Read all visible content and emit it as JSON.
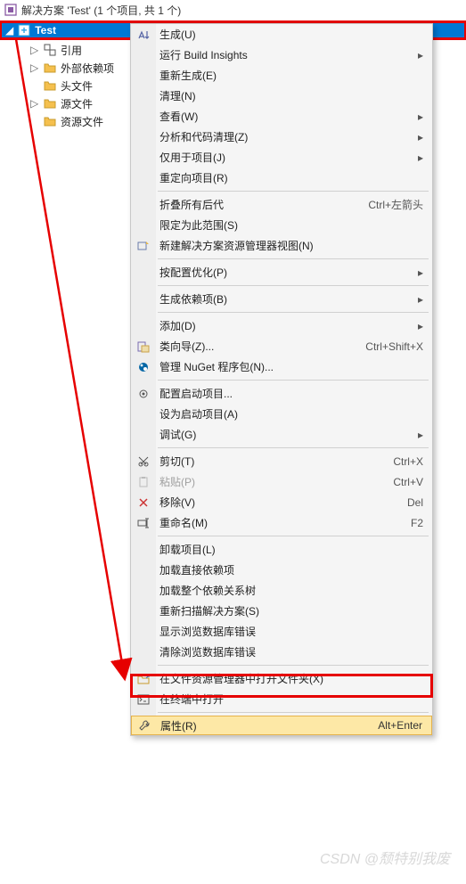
{
  "solution_title": "解决方案 'Test' (1 个项目, 共 1 个)",
  "project_name": "Test",
  "tree": {
    "references": "引用",
    "external_deps": "外部依赖项",
    "headers": "头文件",
    "sources": "源文件",
    "resources": "资源文件"
  },
  "menu": {
    "build": "生成(U)",
    "build_insights": "运行 Build Insights",
    "rebuild": "重新生成(E)",
    "clean": "清理(N)",
    "view": "查看(W)",
    "analyze": "分析和代码清理(Z)",
    "project_only": "仅用于项目(J)",
    "retarget": "重定向项目(R)",
    "collapse_all": "折叠所有后代",
    "collapse_shortcut": "Ctrl+左箭头",
    "scope_to_this": "限定为此范围(S)",
    "new_solution_explorer": "新建解决方案资源管理器视图(N)",
    "optimize_config": "按配置优化(P)",
    "build_deps": "生成依赖项(B)",
    "add": "添加(D)",
    "class_wizard": "类向导(Z)...",
    "class_wizard_shortcut": "Ctrl+Shift+X",
    "manage_nuget": "管理 NuGet 程序包(N)...",
    "configure_startup": "配置启动项目...",
    "set_as_startup": "设为启动项目(A)",
    "debug": "调试(G)",
    "cut": "剪切(T)",
    "cut_shortcut": "Ctrl+X",
    "paste": "粘贴(P)",
    "paste_shortcut": "Ctrl+V",
    "remove": "移除(V)",
    "remove_shortcut": "Del",
    "rename": "重命名(M)",
    "rename_shortcut": "F2",
    "unload": "卸载项目(L)",
    "load_direct_deps": "加载直接依赖项",
    "load_all_deps": "加载整个依赖关系树",
    "rescan": "重新扫描解决方案(S)",
    "show_browse_db_errors": "显示浏览数据库错误",
    "clear_browse_db_errors": "清除浏览数据库错误",
    "open_in_explorer": "在文件资源管理器中打开文件夹(X)",
    "open_in_terminal": "在终端中打开",
    "properties": "属性(R)",
    "properties_shortcut": "Alt+Enter"
  },
  "watermark": "CSDN @颓特别我废"
}
